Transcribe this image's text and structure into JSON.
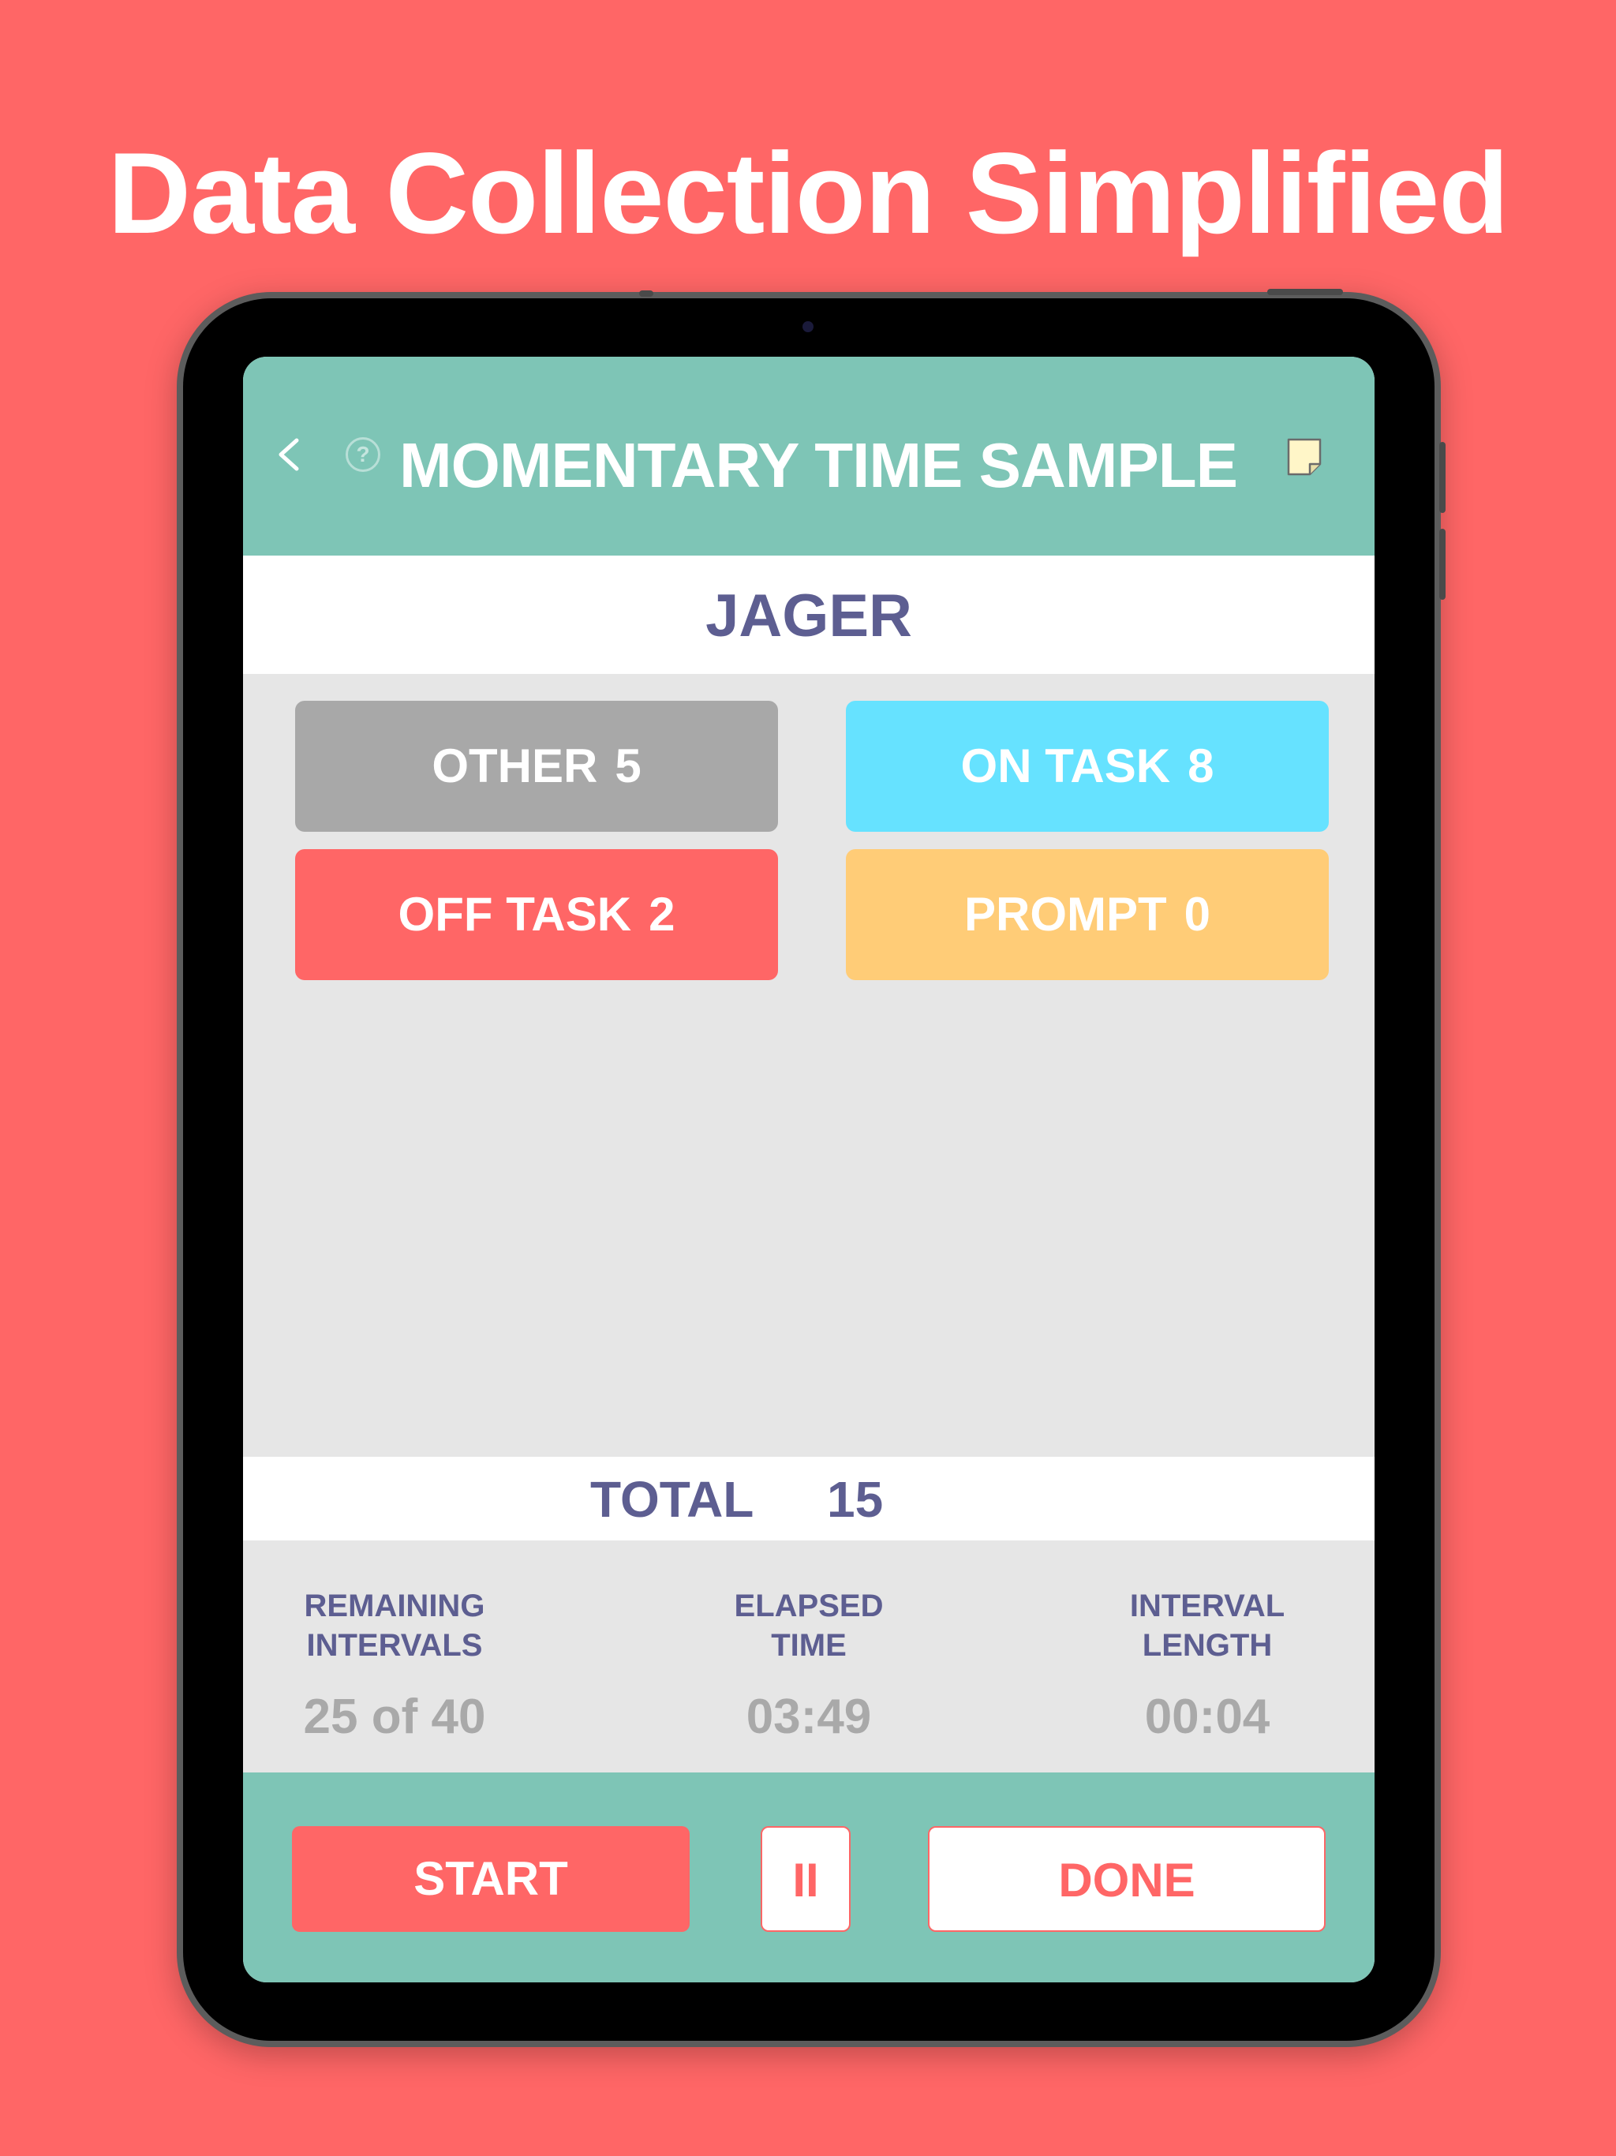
{
  "headline": "Data Collection Simplified",
  "header": {
    "title": "MOMENTARY TIME SAMPLE",
    "back_icon": "chevron-left-icon",
    "help_icon": "question-circle-icon",
    "help_glyph": "?",
    "note_icon": "sticky-note-icon"
  },
  "student": {
    "name": "JAGER"
  },
  "tiles": [
    {
      "label": "OTHER",
      "count": "5",
      "color": "#A8A8A8"
    },
    {
      "label": "ON TASK",
      "count": "8",
      "color": "#66E2FF"
    },
    {
      "label": "OFF TASK",
      "count": "2",
      "color": "#FF6666"
    },
    {
      "label": "PROMPT",
      "count": "0",
      "color": "#FFCC77"
    }
  ],
  "total": {
    "label": "TOTAL",
    "value": "15"
  },
  "stats": {
    "remaining": {
      "label_line1": "REMAINING",
      "label_line2": "INTERVALS",
      "value": "25 of 40"
    },
    "elapsed": {
      "label_line1": "ELAPSED",
      "label_line2": "TIME",
      "value": "03:49"
    },
    "interval": {
      "label_line1": "INTERVAL",
      "label_line2": "LENGTH",
      "value": "00:04"
    }
  },
  "controls": {
    "start_label": "START",
    "pause_label": "II",
    "done_label": "DONE"
  },
  "colors": {
    "background": "#FF6666",
    "header_teal": "#7EC5B6",
    "text_navy": "#5D5E91",
    "muted_gray": "#A9A9A9"
  }
}
